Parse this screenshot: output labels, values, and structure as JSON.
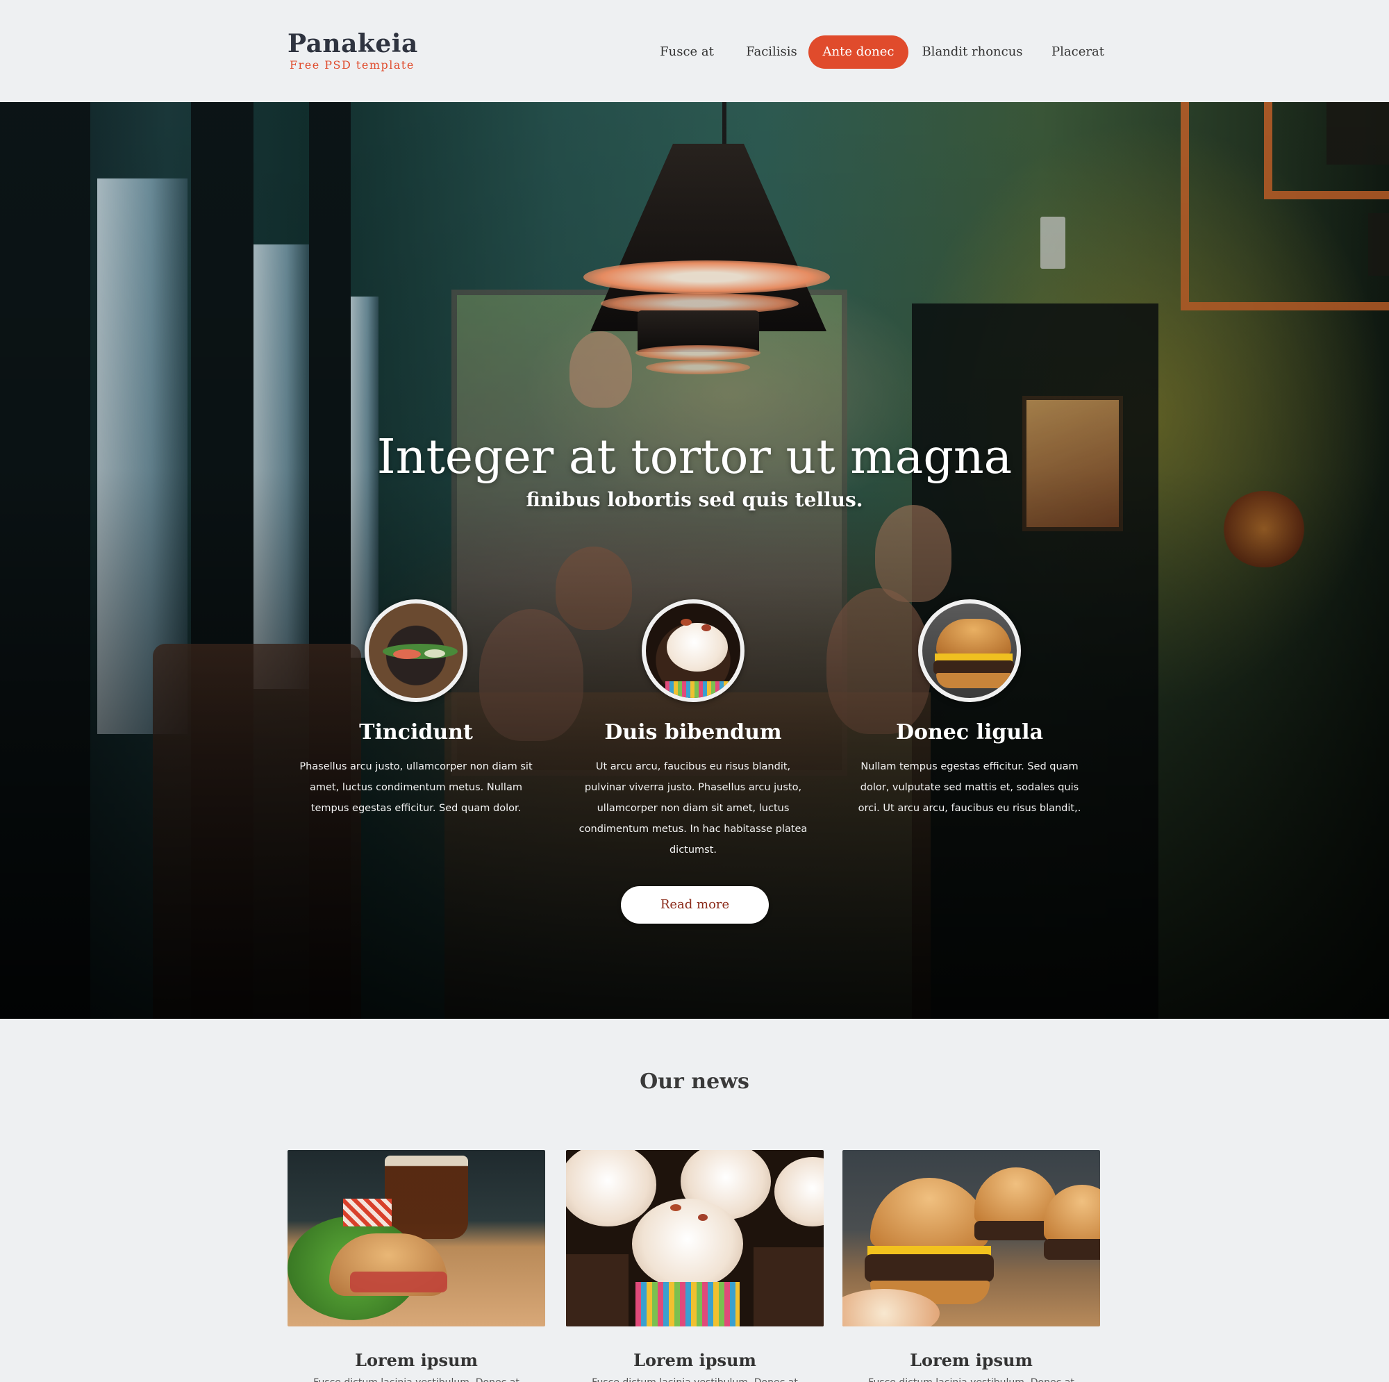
{
  "brand": {
    "name": "Panakeia",
    "tagline": "Free PSD template"
  },
  "nav": {
    "items": [
      {
        "label": "Fusce at",
        "active": false
      },
      {
        "label": "Facilisis",
        "active": false
      },
      {
        "label": "Ante donec",
        "active": true
      },
      {
        "label": "Blandit rhoncus",
        "active": false
      },
      {
        "label": "Placerat",
        "active": false
      }
    ]
  },
  "colors": {
    "accent": "#e04b2c",
    "background": "#eef0f2",
    "text_dark": "#2f3440"
  },
  "hero": {
    "title": "Integer at tortor ut magna",
    "subtitle": "finibus lobortis sed quis tellus.",
    "features": [
      {
        "title": "Tincidunt",
        "text": "Phasellus arcu justo, ullamcorper non diam sit amet, luctus condimentum metus. Nullam tempus egestas efficitur. Sed quam dolor.",
        "image": "dark-burger-photo"
      },
      {
        "title": "Duis bibendum",
        "text": "Ut arcu arcu, faucibus eu risus blandit, pulvinar viverra justo. Phasellus arcu justo, ullamcorper non diam sit amet, luctus condimentum metus. In hac habitasse platea dictumst.",
        "image": "cupcake-photo"
      },
      {
        "title": "Donec ligula",
        "text": "Nullam tempus egestas efficitur. Sed quam dolor, vulputate sed mattis et, sodales quis orci. Ut arcu arcu, faucibus eu risus blandit,.",
        "image": "cheeseburger-photo"
      }
    ],
    "cta_label": "Read more"
  },
  "news": {
    "heading": "Our news",
    "items": [
      {
        "title": "Lorem ipsum",
        "text": "Fusce dictum lacinia vestibulum. Donec at",
        "image": "burger-and-beer-photo"
      },
      {
        "title": "Lorem ipsum",
        "text": "Fusce dictum lacinia vestibulum. Donec at",
        "image": "cupcakes-photo"
      },
      {
        "title": "Lorem ipsum",
        "text": "Fusce dictum lacinia vestibulum. Donec at",
        "image": "burgers-photo"
      }
    ]
  }
}
